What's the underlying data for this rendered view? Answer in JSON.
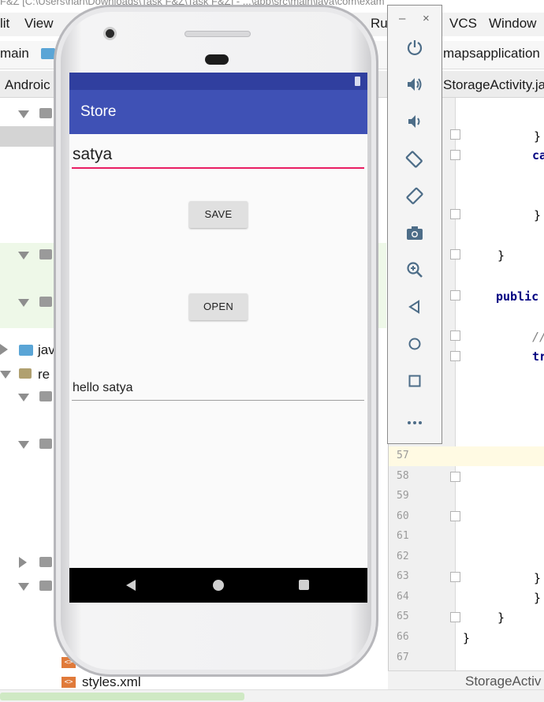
{
  "ide": {
    "title_text": "F&Z [C:\\Users\\hari\\Downloads\\Task F&Z\\Task F&Z] - ...\\app\\src\\main\\java\\com\\exam",
    "menu": [
      "lit",
      "View",
      "Run",
      "VCS",
      "Window"
    ],
    "nav_breadcrumb_main": "main",
    "nav_breadcrumb_module": "mapsapplication",
    "tab_android": "Androic",
    "tab_file": "StorageActivity.java",
    "tree": {
      "java_label": "java",
      "res_label": "re",
      "styles_label": "styles.xml"
    },
    "editor": {
      "line_numbers": [
        "57",
        "58",
        "59",
        "60",
        "61",
        "62",
        "63",
        "64",
        "65",
        "66",
        "67"
      ],
      "code": {
        "brace1": "}",
        "ca": "ca",
        "brace2": "}",
        "brace3": "}",
        "public_kw": "public",
        "comment": "//",
        "tr_kw": "tr",
        "brace63": "}",
        "brace64": "}",
        "brace65": "}",
        "brace66": "}"
      },
      "footer_label": "StorageActiv"
    }
  },
  "emulator_toolbar": {
    "minimize": "–",
    "close": "×",
    "buttons": [
      {
        "name": "power-icon",
        "glyph": "⏻"
      },
      {
        "name": "volume-up-icon",
        "glyph": "🔊"
      },
      {
        "name": "volume-down-icon",
        "glyph": "🔉"
      },
      {
        "name": "rotate-left-icon",
        "glyph": "⟲"
      },
      {
        "name": "rotate-right-icon",
        "glyph": "⟳"
      },
      {
        "name": "camera-icon",
        "glyph": "📷"
      },
      {
        "name": "zoom-icon",
        "glyph": "⊕"
      },
      {
        "name": "back-icon",
        "glyph": "◁"
      },
      {
        "name": "home-icon",
        "glyph": "○"
      },
      {
        "name": "overview-icon",
        "glyph": "□"
      },
      {
        "name": "more-icon",
        "glyph": "⋯"
      }
    ]
  },
  "app": {
    "title": "Store",
    "input_value": "satya",
    "save_label": "SAVE",
    "open_label": "OPEN",
    "output_text": "hello satya",
    "colors": {
      "status_bar": "#303f9f",
      "app_bar": "#3f51b5",
      "accent": "#e91e63"
    }
  }
}
